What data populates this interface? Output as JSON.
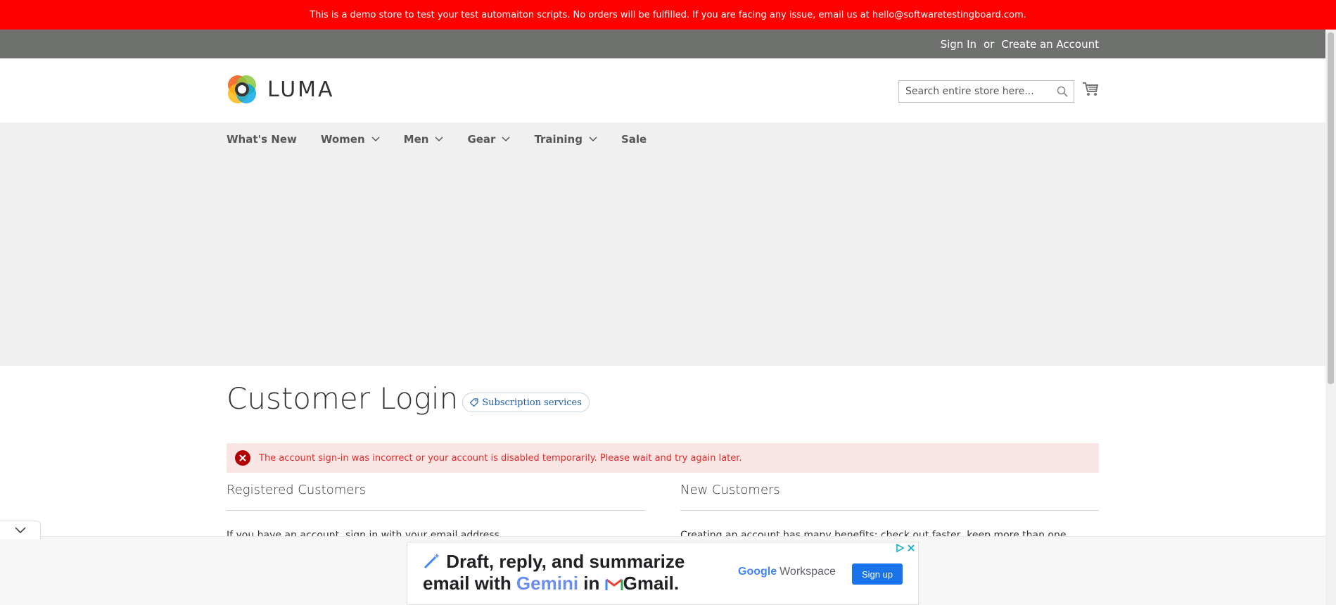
{
  "demo_banner": {
    "text": "This is a demo store to test your test automaiton scripts. No orders will be fulfilled. If you are facing any issue, email us at hello@softwaretestingboard.com."
  },
  "top_links": {
    "sign_in": "Sign In",
    "or": "or",
    "create_account": "Create an Account"
  },
  "header": {
    "logo_text": "LUMA",
    "search": {
      "placeholder": "Search entire store here...",
      "value": ""
    },
    "cart_icon": "cart-icon"
  },
  "nav": {
    "items": [
      {
        "label": "What's New",
        "has_dropdown": false
      },
      {
        "label": "Women",
        "has_dropdown": true
      },
      {
        "label": "Men",
        "has_dropdown": true
      },
      {
        "label": "Gear",
        "has_dropdown": true
      },
      {
        "label": "Training",
        "has_dropdown": true
      },
      {
        "label": "Sale",
        "has_dropdown": false
      }
    ]
  },
  "page": {
    "title": "Customer Login",
    "subscription_badge": "Subscription services"
  },
  "error_message": {
    "text": "The account sign-in was incorrect or your account is disabled temporarily. Please wait and try again later."
  },
  "registered": {
    "title": "Registered Customers",
    "text": "If you have an account, sign in with your email address."
  },
  "new_customers": {
    "title": "New Customers",
    "text": "Creating an account has many benefits: check out faster, keep more than one address, track orders and more."
  },
  "ad": {
    "line1": "Draft, reply, and summarize",
    "line2_prefix": "email with ",
    "line2_gemini": "Gemini",
    "line2_in": " in ",
    "line2_gmail": "Gmail.",
    "brand_google": "Google",
    "brand_workspace": "Workspace",
    "cta": "Sign up"
  },
  "colors": {
    "demo_banner": "#ff0000",
    "top_bar": "#6e716e",
    "nav_bg": "#f0f0f0",
    "error_bg": "#fae5e5",
    "error_text": "#e02b27",
    "ad_button": "#1a73e8"
  }
}
